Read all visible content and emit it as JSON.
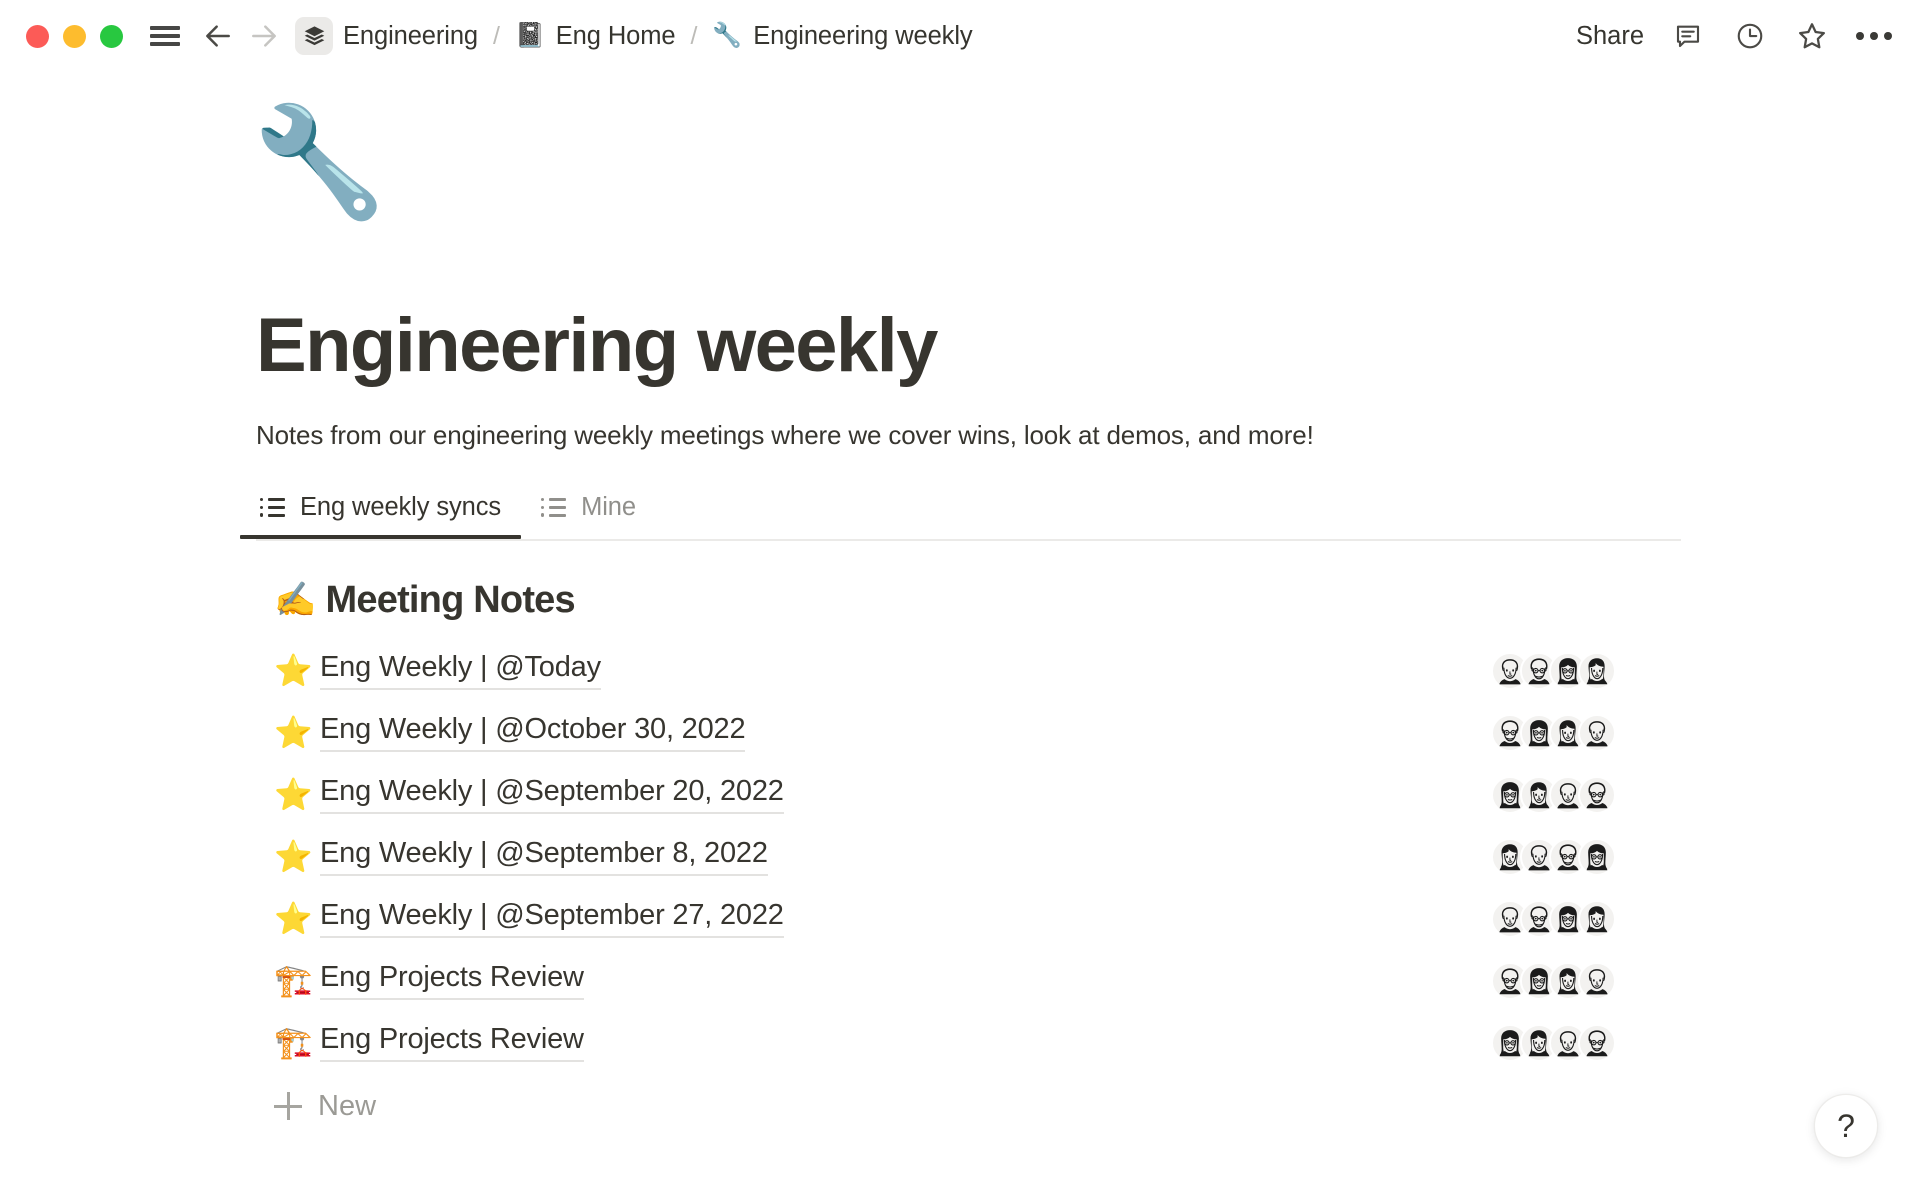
{
  "window_controls": {
    "close_label": "close",
    "minimize_label": "minimize",
    "maximize_label": "maximize",
    "colors": {
      "close": "#FC5B57",
      "minimize": "#FDBC2E",
      "maximize": "#28C840"
    }
  },
  "titlebar": {
    "menu_icon": "hamburger-menu-icon",
    "back_icon": "arrow-left-icon",
    "forward_icon": "arrow-right-icon",
    "workspace_icon": "layers-stack-icon",
    "breadcrumb": [
      {
        "emoji": "",
        "label": "Engineering"
      },
      {
        "emoji": "📓",
        "label": "Eng Home"
      },
      {
        "emoji": "🔧",
        "label": "Engineering weekly"
      }
    ],
    "separator": "/",
    "share_label": "Share",
    "comment_icon": "comment-icon",
    "history_icon": "clock-history-icon",
    "favorite_icon": "star-outline-icon",
    "more_icon": "more-options-icon"
  },
  "page": {
    "emoji": "🔧",
    "title": "Engineering weekly",
    "description": "Notes from our engineering weekly meetings where we cover wins, look at demos, and more!"
  },
  "tabs": [
    {
      "label": "Eng weekly syncs",
      "active": true,
      "icon": "list-view-icon"
    },
    {
      "label": "Mine",
      "active": false,
      "icon": "list-view-icon"
    }
  ],
  "section": {
    "emoji": "✍️",
    "heading": "Meeting Notes"
  },
  "rows": [
    {
      "emoji": "⭐",
      "title": "Eng Weekly | @Today",
      "avatar_count": 4
    },
    {
      "emoji": "⭐",
      "title": "Eng Weekly | @October 30, 2022",
      "avatar_count": 4
    },
    {
      "emoji": "⭐",
      "title": "Eng Weekly | @September 20, 2022",
      "avatar_count": 4
    },
    {
      "emoji": "⭐",
      "title": "Eng Weekly | @September 8, 2022",
      "avatar_count": 4
    },
    {
      "emoji": "⭐",
      "title": "Eng Weekly | @September 27, 2022",
      "avatar_count": 4
    },
    {
      "emoji": "🏗️",
      "title": "Eng Projects Review",
      "avatar_count": 4
    },
    {
      "emoji": "🏗️",
      "title": "Eng Projects Review",
      "avatar_count": 4
    }
  ],
  "new_button": {
    "label": "New",
    "icon": "plus-icon"
  },
  "help_button": {
    "label": "?",
    "icon": "help-icon"
  }
}
